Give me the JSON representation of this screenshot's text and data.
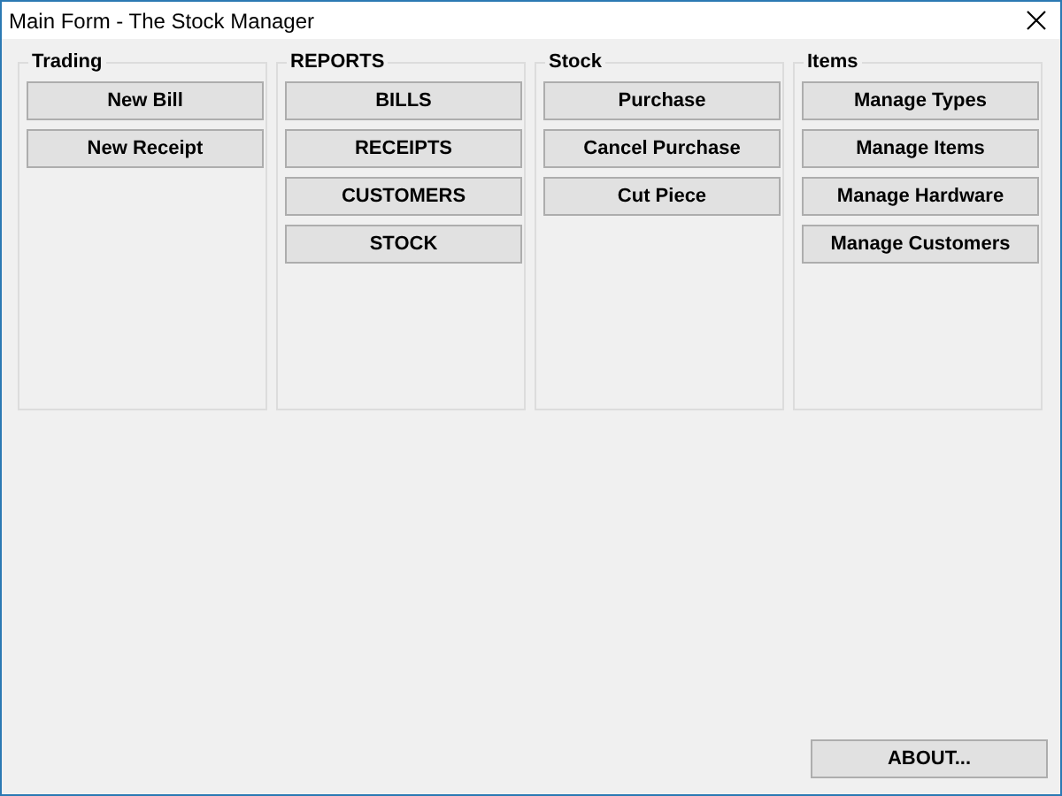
{
  "window": {
    "title": "Main Form - The Stock Manager"
  },
  "groups": [
    {
      "title": "Trading",
      "buttons": [
        "New Bill",
        "New Receipt"
      ]
    },
    {
      "title": "REPORTS",
      "buttons": [
        "BILLS",
        "RECEIPTS",
        "CUSTOMERS",
        "STOCK"
      ]
    },
    {
      "title": "Stock",
      "buttons": [
        "Purchase",
        "Cancel Purchase",
        "Cut Piece"
      ]
    },
    {
      "title": "Items",
      "buttons": [
        "Manage Types",
        "Manage Items",
        "Manage Hardware",
        "Manage Customers"
      ]
    }
  ],
  "about_button": "ABOUT..."
}
